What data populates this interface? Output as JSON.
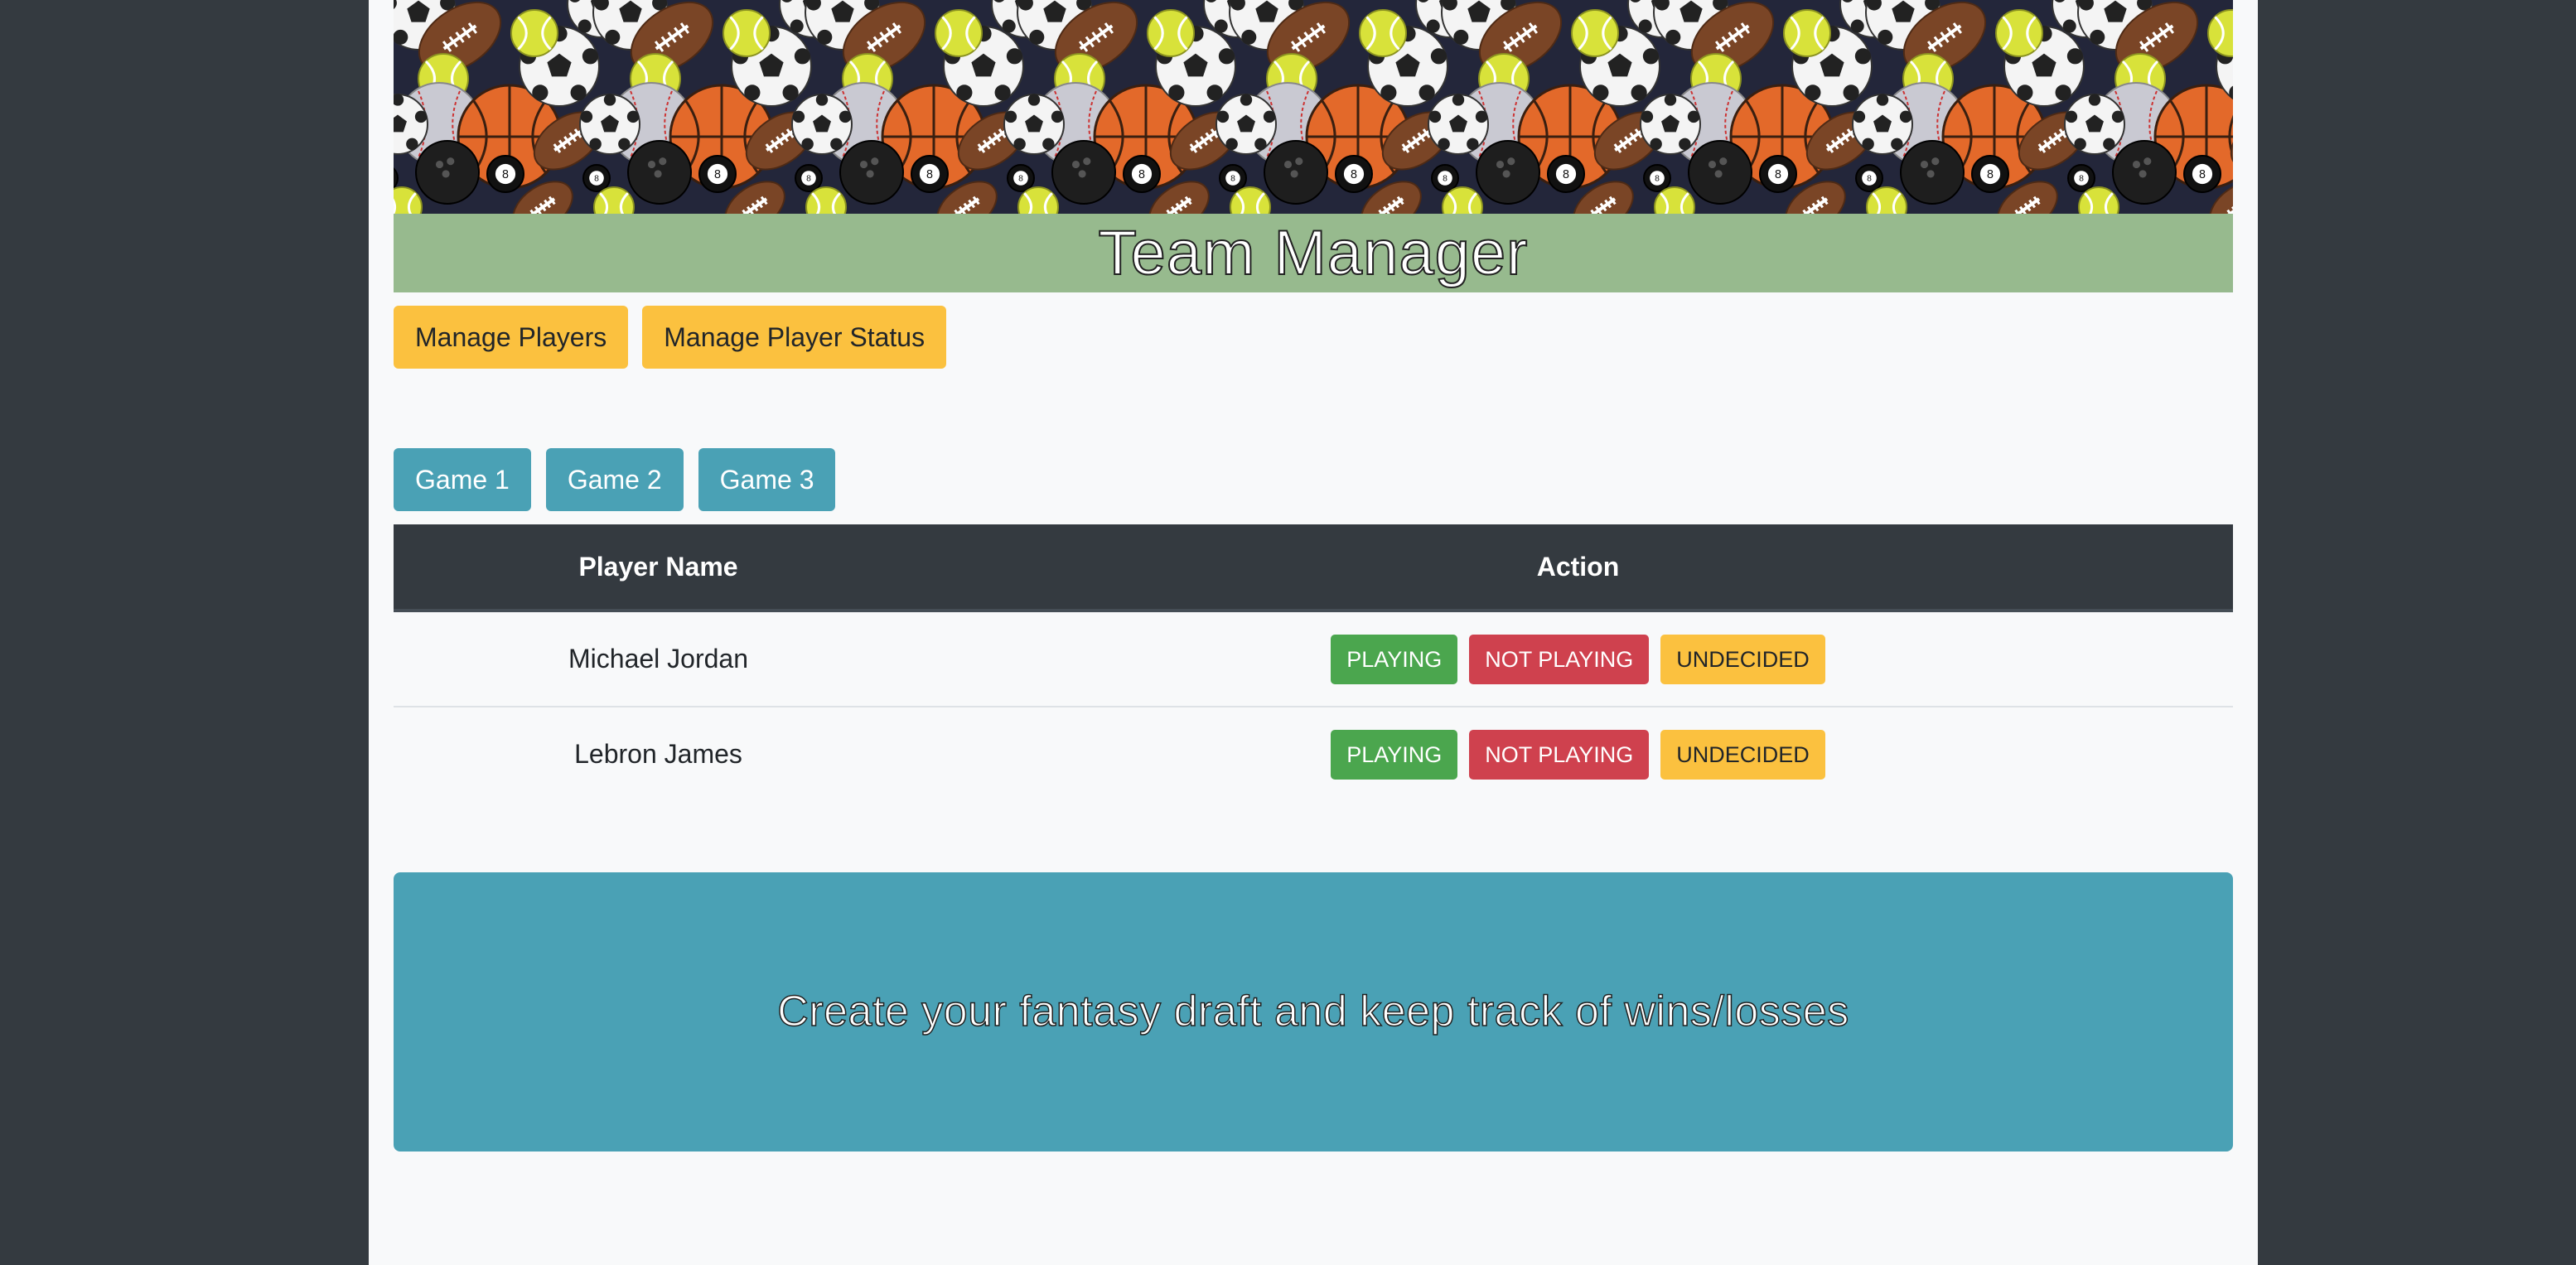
{
  "header": {
    "title": "Team Manager"
  },
  "nav": {
    "manage_players": "Manage Players",
    "manage_player_status": "Manage Player Status"
  },
  "games": [
    "Game 1",
    "Game 2",
    "Game 3"
  ],
  "table": {
    "columns": [
      "Player Name",
      "Action"
    ],
    "rows": [
      {
        "name": "Michael Jordan"
      },
      {
        "name": "Lebron James"
      }
    ],
    "actions": {
      "playing": "PLAYING",
      "not_playing": "NOT PLAYING",
      "undecided": "UNDECIDED"
    }
  },
  "jumbotron": {
    "text": "Create your fantasy draft and keep track of wins/losses"
  },
  "colors": {
    "background_dark": "#343a40",
    "title_bar": "#97ba8e",
    "warning": "#fbc13f",
    "info": "#4aa1b5",
    "success": "#4ba64e",
    "danger": "#cf414e"
  },
  "banner": {
    "icons": [
      "football-icon",
      "soccer-ball-icon",
      "basketball-icon",
      "baseball-icon",
      "tennis-ball-icon",
      "bowling-ball-icon",
      "eight-ball-icon"
    ]
  }
}
